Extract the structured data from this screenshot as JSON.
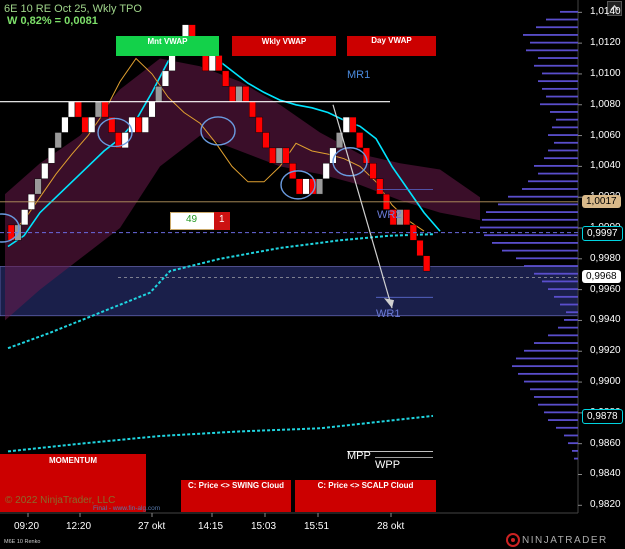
{
  "header": {
    "instrument": "6E 10 RE Oct 25, Wkly TPO",
    "change": "W 0,82% = 0,0081"
  },
  "buttons": {
    "mnt_vwap": "Mnt VWAP",
    "wkly_vwap": "Wkly VWAP",
    "day_vwap": "Day VWAP",
    "momentum": "MOMENTUM",
    "swing_cloud": "C: Price <> SWING Cloud",
    "scalp_cloud": "C: Price <> SCALP Cloud"
  },
  "labels": {
    "mr1": "MR1",
    "wr2": "WR2",
    "wr1": "WR1",
    "mpp": "MPP",
    "wpp": "WPP",
    "counter_value": "49",
    "counter_badge": "1"
  },
  "footer": {
    "copyright": "© 2022 NinjaTrader, LLC",
    "website": "Final - www.fin-alg.com",
    "bottom_left": "M6E 10 Renko",
    "logo": "NINJATRADER"
  },
  "colors": {
    "up": "#ffffff",
    "up_gray": "#9a9a9a",
    "down": "#ff0000",
    "monthly_vwap": "#00e5ff",
    "weekly_vwap": "#e0a030",
    "volume_profile": "#5a4ecc",
    "cloud": "#6a1a4a",
    "value_area": "#1a1f4a"
  },
  "chart_data": {
    "type": "line",
    "x_ticks": [
      "09:20",
      "12:20",
      "27 okt",
      "14:15",
      "15:03",
      "15:51",
      "28 okt"
    ],
    "y_ticks": [
      "1,0140",
      "1,0120",
      "1,0100",
      "1,0080",
      "1,0060",
      "1,0040",
      "1,0020",
      "1,0000",
      "0,9980",
      "0,9960",
      "0,9940",
      "0,9920",
      "0,9900",
      "0,9880",
      "0,9860",
      "0,9840",
      "0,9820"
    ],
    "ylim": [
      0.9815,
      1.0148
    ],
    "price_tags": [
      {
        "text": "1,0017",
        "value": 1.0017,
        "style": "tan"
      },
      {
        "text": "0,9997",
        "value": 0.9997,
        "style": "cyan"
      },
      {
        "text": "0,9968",
        "value": 0.9968,
        "style": "white"
      },
      {
        "text": "0,9878",
        "value": 0.9878,
        "style": "cyan"
      }
    ],
    "renko_brick_size": 0.001,
    "renko_bricks": [
      {
        "dir": "down",
        "v": 0.9992
      },
      {
        "dir": "up",
        "v": 1.0002
      },
      {
        "dir": "up",
        "v": 1.0012
      },
      {
        "dir": "up",
        "v": 1.0022
      },
      {
        "dir": "up",
        "v": 1.0032
      },
      {
        "dir": "up",
        "v": 1.0042
      },
      {
        "dir": "up",
        "v": 1.0052
      },
      {
        "dir": "up",
        "v": 1.0062
      },
      {
        "dir": "up",
        "v": 1.0072
      },
      {
        "dir": "up",
        "v": 1.0082
      },
      {
        "dir": "down",
        "v": 1.0072
      },
      {
        "dir": "down",
        "v": 1.0062
      },
      {
        "dir": "up",
        "v": 1.0072
      },
      {
        "dir": "up",
        "v": 1.0082
      },
      {
        "dir": "down",
        "v": 1.0072
      },
      {
        "dir": "down",
        "v": 1.0062
      },
      {
        "dir": "down",
        "v": 1.0052
      },
      {
        "dir": "up",
        "v": 1.0062
      },
      {
        "dir": "up",
        "v": 1.0072
      },
      {
        "dir": "down",
        "v": 1.0062
      },
      {
        "dir": "up",
        "v": 1.0072
      },
      {
        "dir": "up",
        "v": 1.0082
      },
      {
        "dir": "up",
        "v": 1.0092
      },
      {
        "dir": "up",
        "v": 1.0102
      },
      {
        "dir": "up",
        "v": 1.0112
      },
      {
        "dir": "up",
        "v": 1.0122
      },
      {
        "dir": "up",
        "v": 1.0132
      },
      {
        "dir": "down",
        "v": 1.0122
      },
      {
        "dir": "down",
        "v": 1.0112
      },
      {
        "dir": "down",
        "v": 1.0102
      },
      {
        "dir": "up",
        "v": 1.0112
      },
      {
        "dir": "down",
        "v": 1.0102
      },
      {
        "dir": "down",
        "v": 1.0092
      },
      {
        "dir": "down",
        "v": 1.0082
      },
      {
        "dir": "up",
        "v": 1.0092
      },
      {
        "dir": "down",
        "v": 1.0082
      },
      {
        "dir": "down",
        "v": 1.0072
      },
      {
        "dir": "down",
        "v": 1.0062
      },
      {
        "dir": "down",
        "v": 1.0052
      },
      {
        "dir": "down",
        "v": 1.0042
      },
      {
        "dir": "up",
        "v": 1.0052
      },
      {
        "dir": "down",
        "v": 1.0042
      },
      {
        "dir": "down",
        "v": 1.0032
      },
      {
        "dir": "down",
        "v": 1.0022
      },
      {
        "dir": "up",
        "v": 1.0032
      },
      {
        "dir": "down",
        "v": 1.0022
      },
      {
        "dir": "up",
        "v": 1.0032
      },
      {
        "dir": "up",
        "v": 1.0042
      },
      {
        "dir": "up",
        "v": 1.0052
      },
      {
        "dir": "up",
        "v": 1.0062
      },
      {
        "dir": "up",
        "v": 1.0072
      },
      {
        "dir": "down",
        "v": 1.0062
      },
      {
        "dir": "down",
        "v": 1.0052
      },
      {
        "dir": "down",
        "v": 1.0042
      },
      {
        "dir": "down",
        "v": 1.0032
      },
      {
        "dir": "down",
        "v": 1.0022
      },
      {
        "dir": "down",
        "v": 1.0012
      },
      {
        "dir": "down",
        "v": 1.0002
      },
      {
        "dir": "up",
        "v": 1.0012
      },
      {
        "dir": "down",
        "v": 1.0002
      },
      {
        "dir": "down",
        "v": 0.9992
      },
      {
        "dir": "down",
        "v": 0.9982
      },
      {
        "dir": "down",
        "v": 0.9972
      }
    ],
    "series": [
      {
        "name": "Mnt VWAP",
        "color": "#00e5ff",
        "values": [
          0.9988,
          0.9995,
          1.001,
          1.002,
          1.003,
          1.004,
          1.005,
          1.0058,
          1.007,
          1.0088,
          1.0108,
          1.0122,
          1.0118,
          1.011,
          1.0102,
          1.0094,
          1.0088,
          1.0083,
          1.008,
          1.0078,
          1.0075,
          1.007,
          1.0066,
          1.0058,
          1.004,
          1.0025,
          1.001,
          0.9998
        ]
      },
      {
        "name": "Wkly VWAP",
        "color": "#e0a030",
        "values": [
          0.9995,
          1.0005,
          1.002,
          1.0035,
          1.0048,
          1.006,
          1.0075,
          1.0095,
          1.011,
          1.01,
          1.0085,
          1.0075,
          1.0068,
          1.0055,
          1.004,
          1.003,
          1.003,
          1.004,
          1.0055,
          1.005,
          1.0048,
          1.0045,
          1.004,
          1.003,
          1.0015,
          1.0005,
          0.9998
        ]
      }
    ],
    "levels": [
      {
        "name": "MR1",
        "value": 1.0122
      },
      {
        "name": "WR2",
        "value": 1.0025
      },
      {
        "name": "WR1",
        "value": 0.9955
      },
      {
        "name": "MPP",
        "value": 0.9855
      },
      {
        "name": "WPP",
        "value": 0.9851
      }
    ]
  }
}
